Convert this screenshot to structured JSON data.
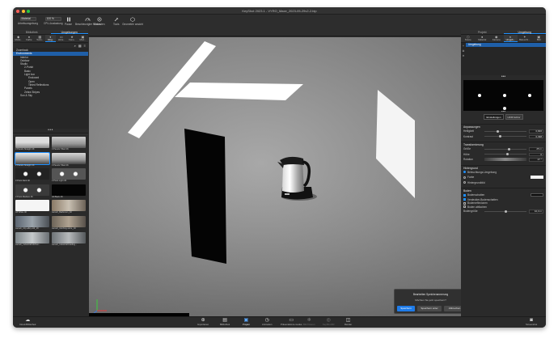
{
  "window": {
    "title": "KeyShot 2023.1 - VYRO_Maxe_2023-05-29v2-2.bip"
  },
  "toolbar": {
    "workgroup_select": "Material",
    "workgroup_label": "Arbeitsumgebung",
    "cpu_select": "100 %",
    "cpu_label": "CPU-Auslastung",
    "pause_label": "Pause",
    "performance_label": "Beschleunigter Modus",
    "camera_label": "Einrasten",
    "tools_label": "Tools",
    "geometry_label": "Geometrie ansicht"
  },
  "left_panel": {
    "header_tabs": [
      "Bibliothek",
      "Umgebungen"
    ],
    "active_header": "Umgebungen",
    "tabs": [
      "Modu..",
      "Farbe",
      "Textu..",
      "Umg..",
      "Hinte..",
      "Favo..",
      "Mod..."
    ],
    "active_tab": "Umg..",
    "tree": [
      "Zoomback",
      "Environments",
      "Interior",
      "Outdoor",
      "Studio",
      "2-Punkt",
      "Basic",
      "Light box",
      "Enclosed",
      "Open",
      "Tinted Reflections",
      "Panels",
      "Zebra Stripes",
      "Sun & Sky"
    ],
    "selected_tree": "Environments",
    "thumbs": [
      "3 Panels Straight 4K",
      "3 Panels Tilted 4K",
      "2 Panels Straight 4K",
      "3 Panels Tilted 4K",
      "3 Point Dark 4K",
      "3 Point Light 4K",
      "3 Point Medium 4K",
      "All Black 4K",
      "All White 4K",
      "Aerodr_Bathroom_4K",
      "Aerodr_City-alley-old_1K",
      "Aerodr_Clothing-store_1K",
      "Aerodr_Industrial-kitchen...",
      "Aerodr_Industrial-loading..."
    ],
    "selected_thumb": "2 Panels Straight 4K"
  },
  "right_panel": {
    "header_tabs": [
      "Projekt",
      "Umgebung"
    ],
    "active_header": "Umgebung",
    "tabs": [
      "Szene",
      "Material",
      "Kamera",
      "Umgeb...",
      "Beleucht...",
      "Bild"
    ],
    "active_tab": "Umgeb...",
    "env_list_item": "Umgebung",
    "preview_buttons": [
      "Einstellungen",
      "HDRI Editor"
    ],
    "sections": {
      "adjust": {
        "title": "Anpassungen",
        "rows": [
          {
            "label": "Helligkeit",
            "value": "0,846",
            "level": 0.32
          },
          {
            "label": "Kontrast",
            "value": "0,398",
            "level": 0.38
          }
        ]
      },
      "transform": {
        "title": "Transformierung",
        "rows": [
          {
            "label": "Größe",
            "value": "25 m",
            "level": 0.58
          },
          {
            "label": "Höhe",
            "value": "0",
            "level": 0.55
          },
          {
            "label": "Rotation",
            "value": "27 °",
            "level": 0.5
          }
        ]
      },
      "background": {
        "title": "Hintergrund",
        "options": [
          "Beleuchtungs-Umgebung",
          "Farbe",
          "Hintergrundbild"
        ],
        "selected": "Beleuchtungs-Umgebung"
      },
      "ground": {
        "title": "Boden",
        "options": [
          "Bodenschatten",
          "Verdeckter-Bodenschatten",
          "Bodenreflexionen",
          "Boden abflachen"
        ],
        "checked": [
          "Bodenschatten",
          "Verdeckter-Bodenschatten"
        ],
        "size_label": "Bodengröße",
        "size_value": "10,3 m",
        "size_level": 0.5
      }
    }
  },
  "dialog": {
    "title": "Bearbeiten Speicheranmerung",
    "message": "Möchten Sie jetzt speichern?",
    "buttons": [
      "Speichern",
      "Speichern unter",
      "Abbrechen"
    ]
  },
  "bottom_bar": {
    "left_item": "Cloud-Bibliothek",
    "items": [
      "Importieren",
      "Bibliothek",
      "Projekt",
      "Animation",
      "Präsentations-modus",
      "Bild fixieren",
      "KeyShotXR",
      "Render"
    ],
    "active": "Projekt",
    "right_item": "Screenshot"
  },
  "colors": {
    "accent": "#1e90ff",
    "close": "#ff5f57",
    "minimize": "#febc2e",
    "maximize": "#28c840"
  }
}
